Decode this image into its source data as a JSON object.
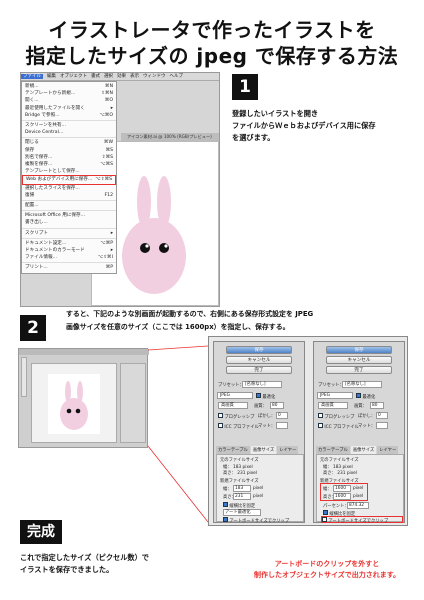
{
  "title": {
    "line1": "イラストレータで作ったイラストを",
    "line2": "指定したサイズの jpeg で保存する方法"
  },
  "step1": {
    "number": "1",
    "text_lines": [
      "登録したいイラストを開き",
      "ファイルからＷｅｂおよびデバイス用に保存",
      "を選びます。"
    ]
  },
  "step2": {
    "number": "2",
    "text_lines": [
      "すると、下記のような別画面が起動するので、右側にある保存形式設定を JPEG",
      "画像サイズを任意のサイズ（ここでは 1600px）を指定し、保存する。"
    ]
  },
  "done": {
    "badge": "完成",
    "text_lines": [
      "これで指定したサイズ（ピクセル数）で",
      "イラストを保存できました。"
    ]
  },
  "note": {
    "text_lines": [
      "アートボードのクリップを外すと",
      "制作したオブジェクトサイズで出力されます。"
    ]
  },
  "menubar": {
    "items": [
      "ファイル",
      "編集",
      "オブジェクト",
      "書式",
      "選択",
      "効果",
      "表示",
      "ウィンドウ",
      "ヘルプ"
    ]
  },
  "file_menu": {
    "items": [
      {
        "label": "新規...",
        "key": "⌘N"
      },
      {
        "label": "テンプレートから新規...",
        "key": "⇧⌘N"
      },
      {
        "label": "開く...",
        "key": "⌘O"
      },
      {
        "label": "最近使用したファイルを開く",
        "key": "▸"
      },
      {
        "label": "Bridge で参照...",
        "key": "⌥⌘O"
      },
      {
        "label": "スクリーンを共有...",
        "key": ""
      },
      {
        "label": "Device Central...",
        "key": ""
      },
      {
        "label": "閉じる",
        "key": "⌘W"
      },
      {
        "label": "保存",
        "key": "⌘S"
      },
      {
        "label": "別名で保存...",
        "key": "⇧⌘S"
      },
      {
        "label": "複製を保存...",
        "key": "⌥⌘S"
      },
      {
        "label": "テンプレートとして保存...",
        "key": ""
      },
      {
        "label": "Web およびデバイス用に保存...",
        "key": "⌥⇧⌘S"
      },
      {
        "label": "選択したスライスを保存...",
        "key": ""
      },
      {
        "label": "復帰",
        "key": "F12"
      },
      {
        "label": "配置...",
        "key": ""
      },
      {
        "label": "Microsoft Office 用に保存...",
        "key": ""
      },
      {
        "label": "書き出し...",
        "key": ""
      },
      {
        "label": "スクリプト",
        "key": "▸"
      },
      {
        "label": "ドキュメント設定...",
        "key": "⌥⌘P"
      },
      {
        "label": "ドキュメントのカラーモード",
        "key": "▸"
      },
      {
        "label": "ファイル情報...",
        "key": "⌥⇧⌘I"
      },
      {
        "label": "プリント...",
        "key": "⌘P"
      }
    ]
  },
  "doc_tab": "アイコン素材.ai @ 100% (RGB/プレビュー)",
  "save_panel": {
    "save": "保存",
    "cancel": "キャンセル",
    "done": "完了",
    "preset_label": "プリセット：",
    "preset_value": "[名称なし]",
    "format": "JPEG",
    "quality_label": "画質：",
    "quality_value": "80",
    "quality_level": "高画質",
    "optimize": "最適化",
    "progressive": "プログレッシブ",
    "blur_label": "ぼかし：",
    "blur_value": "0",
    "icc": "ICC プロファイル",
    "matte_label": "マット：",
    "tabs": [
      "カラーテーブル",
      "画像サイズ",
      "レイヤー"
    ],
    "orig_size_label": "元のファイルサイズ",
    "orig_w_label": "幅：",
    "orig_w_value": "183 pixel",
    "orig_h_label": "高さ：",
    "orig_h_value": "231 pixel",
    "new_size_label": "新規ファイルサイズ",
    "w_label": "幅：",
    "h_label": "高さ：",
    "unit": "pixel",
    "left_w": "183",
    "left_h": "231",
    "right_w": "1600",
    "right_h": "1600",
    "percent_label": "パーセント：",
    "percent_value": "874.32",
    "constrain": "縦横比を固定",
    "quality_method": "アート最適化",
    "clip": "アートボードサイズでクリップ"
  }
}
